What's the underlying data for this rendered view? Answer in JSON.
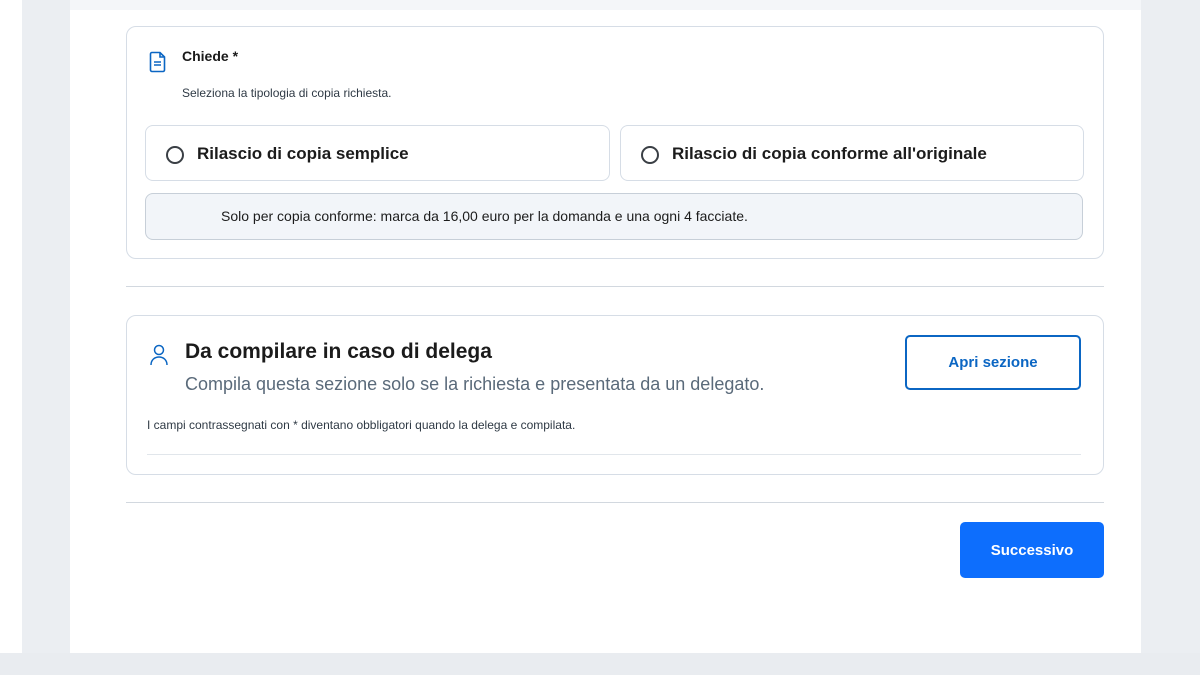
{
  "chiede": {
    "title": "Chiede *",
    "subtitle": "Seleziona la tipologia di copia richiesta.",
    "icon": "document-icon",
    "options": [
      {
        "label": "Rilascio di copia semplice",
        "selected": false
      },
      {
        "label": "Rilascio di copia conforme all'originale",
        "selected": false
      }
    ],
    "note": "Solo per copia conforme: marca da 16,00 euro per la domanda e una ogni 4 facciate."
  },
  "delega": {
    "icon": "user-icon",
    "title": "Da compilare in caso di delega",
    "subtitle": "Compila questa sezione solo se la richiesta e presentata da un delegato.",
    "hint": "I campi contrassegnati con * diventano obbligatori quando la delega e compilata.",
    "open_button": "Apri sezione"
  },
  "footer": {
    "next_button": "Successivo"
  },
  "colors": {
    "primary": "#0d6efd",
    "outline": "#0b66c3",
    "background": "#ebeef2"
  }
}
